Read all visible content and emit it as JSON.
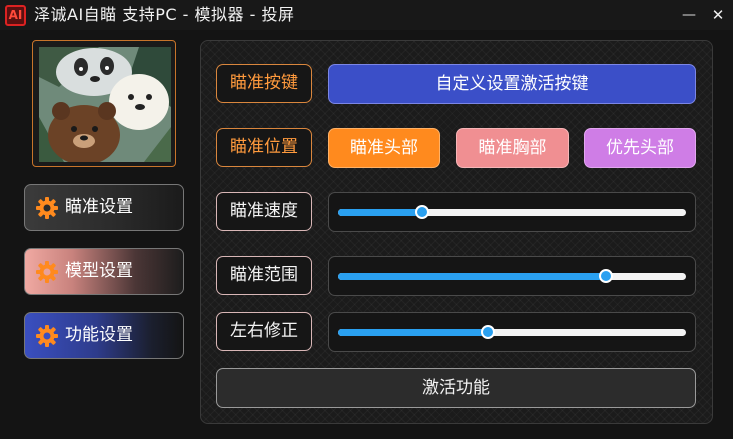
{
  "window": {
    "icon_text": "AI",
    "title": "泽诚AI自瞄   支持PC - 模拟器 - 投屏",
    "minimize": "—",
    "close": "✕"
  },
  "sidebar": {
    "avatar": "cartoon-bears-image",
    "items": [
      {
        "label": "瞄准设置",
        "icon": "gear-icon"
      },
      {
        "label": "模型设置",
        "icon": "gear-icon"
      },
      {
        "label": "功能设置",
        "icon": "gear-icon"
      }
    ]
  },
  "panel": {
    "aim_key": {
      "label": "瞄准按键",
      "button": "自定义设置激活按键"
    },
    "aim_position": {
      "label": "瞄准位置",
      "options": [
        "瞄准头部",
        "瞄准胸部",
        "优先头部"
      ]
    },
    "aim_speed": {
      "label": "瞄准速度",
      "value": 0.24
    },
    "aim_range": {
      "label": "瞄准范围",
      "value": 0.77
    },
    "lr_correction": {
      "label": "左右修正",
      "value": 0.43
    },
    "activate": "激活功能"
  },
  "colors": {
    "accent_blue": "#3b4fc8",
    "orange": "#ff8a1e",
    "pink": "#f08f92",
    "purple": "#cf7de6",
    "slider": "#2aa0f0"
  }
}
